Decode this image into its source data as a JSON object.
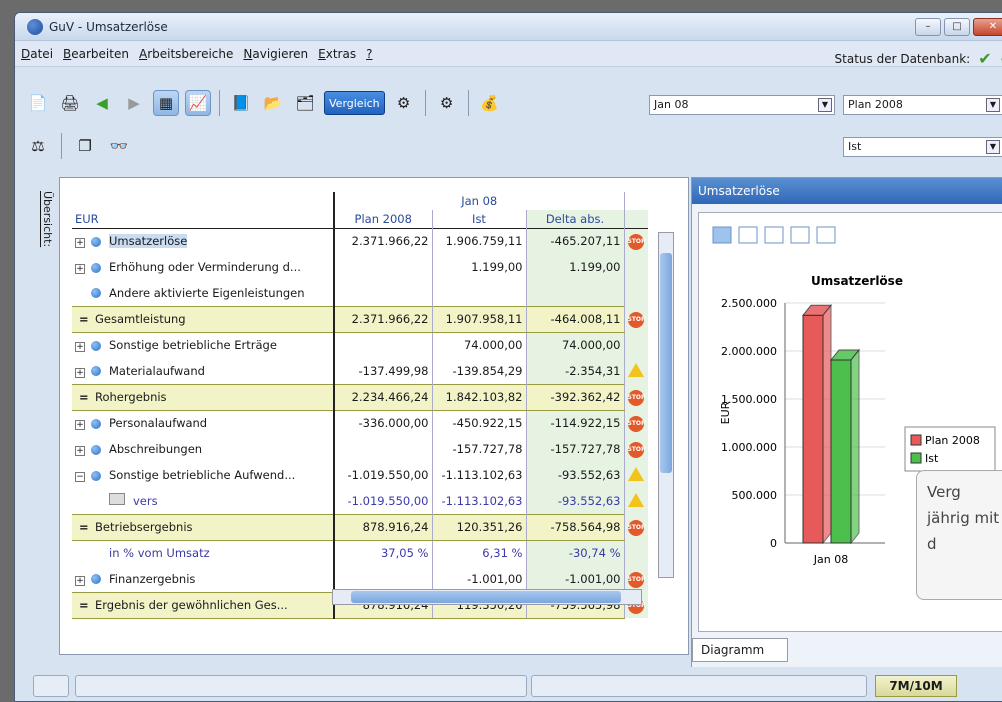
{
  "window": {
    "title": "GuV - Umsatzerlöse"
  },
  "menu": [
    {
      "u": "D",
      "rest": "atei"
    },
    {
      "u": "B",
      "rest": "earbeiten"
    },
    {
      "u": "A",
      "rest": "rbeitsbereiche"
    },
    {
      "u": "N",
      "rest": "avigieren"
    },
    {
      "u": "E",
      "rest": "xtras"
    },
    {
      "u": "?",
      "rest": ""
    }
  ],
  "db_status": "Status der Datenbank:",
  "toolbar": {
    "vergleich": "Vergleich"
  },
  "selects": {
    "period": "Jan 08",
    "plan": "Plan 2008",
    "ist": "Ist"
  },
  "side_label": "Übersicht:",
  "table": {
    "period_header": "Jan 08",
    "currency": "EUR",
    "cols": [
      "Plan 2008",
      "Ist",
      "Delta abs."
    ],
    "rows": [
      {
        "type": "exp",
        "label": "Umsatzerlöse",
        "plan": "2.371.966,22",
        "ist": "1.906.759,11",
        "delta": "-465.207,11",
        "icon": "stop",
        "link": true
      },
      {
        "type": "exp",
        "label": "Erhöhung oder Verminderung d...",
        "plan": "",
        "ist": "1.199,00",
        "delta": "1.199,00",
        "icon": ""
      },
      {
        "type": "dot",
        "label": "Andere aktivierte Eigenleistungen",
        "plan": "",
        "ist": "",
        "delta": "",
        "icon": ""
      },
      {
        "type": "sum",
        "label": "Gesamtleistung",
        "plan": "2.371.966,22",
        "ist": "1.907.958,11",
        "delta": "-464.008,11",
        "icon": "stop"
      },
      {
        "type": "exp",
        "label": "Sonstige betriebliche Erträge",
        "plan": "",
        "ist": "74.000,00",
        "delta": "74.000,00",
        "icon": ""
      },
      {
        "type": "exp",
        "label": "Materialaufwand",
        "plan": "-137.499,98",
        "ist": "-139.854,29",
        "delta": "-2.354,31",
        "icon": "warn"
      },
      {
        "type": "sum",
        "label": "Rohergebnis",
        "plan": "2.234.466,24",
        "ist": "1.842.103,82",
        "delta": "-392.362,42",
        "icon": "stop"
      },
      {
        "type": "exp",
        "label": "Personalaufwand",
        "plan": "-336.000,00",
        "ist": "-450.922,15",
        "delta": "-114.922,15",
        "icon": "stop"
      },
      {
        "type": "exp",
        "label": "Abschreibungen",
        "plan": "",
        "ist": "-157.727,78",
        "delta": "-157.727,78",
        "icon": "stop"
      },
      {
        "type": "coll",
        "label": "Sonstige betriebliche Aufwend...",
        "plan": "-1.019.550,00",
        "ist": "-1.113.102,63",
        "delta": "-93.552,63",
        "icon": "warn"
      },
      {
        "type": "sub",
        "label": "vers",
        "plan": "-1.019.550,00",
        "ist": "-1.113.102,63",
        "delta": "-93.552,63",
        "icon": "warn"
      },
      {
        "type": "sum",
        "label": "Betriebsergebnis",
        "plan": "878.916,24",
        "ist": "120.351,26",
        "delta": "-758.564,98",
        "icon": "stop"
      },
      {
        "type": "pct",
        "label": "in % vom Umsatz",
        "plan": "37,05 %",
        "ist": "6,31 %",
        "delta": "-30,74 %",
        "icon": ""
      },
      {
        "type": "exp",
        "label": "Finanzergebnis",
        "plan": "",
        "ist": "-1.001,00",
        "delta": "-1.001,00",
        "icon": "stop"
      },
      {
        "type": "sum",
        "label": "Ergebnis der gewöhnlichen Ges...",
        "plan": "878.916,24",
        "ist": "119.350,26",
        "delta": "-759.565,98",
        "icon": "stop"
      }
    ]
  },
  "chart_panel": {
    "title": "Umsatzerlöse",
    "tab": "Diagramm"
  },
  "chart_data": {
    "type": "bar",
    "title": "Umsatzerlöse",
    "ylabel": "EUR",
    "categories": [
      "Jan 08"
    ],
    "series": [
      {
        "name": "Plan 2008",
        "values": [
          2371966.22
        ],
        "color": "#e85a5a"
      },
      {
        "name": "Ist",
        "values": [
          1906759.11
        ],
        "color": "#4cbf4c"
      }
    ],
    "ylim": [
      0,
      2500000
    ],
    "yticks": [
      "0",
      "500.000",
      "1.000.000",
      "1.500.000",
      "2.000.000",
      "2.500.000"
    ],
    "legend": "right"
  },
  "tooltip": "Verg jährig mit d",
  "status": {
    "memory": "7M/10M"
  }
}
